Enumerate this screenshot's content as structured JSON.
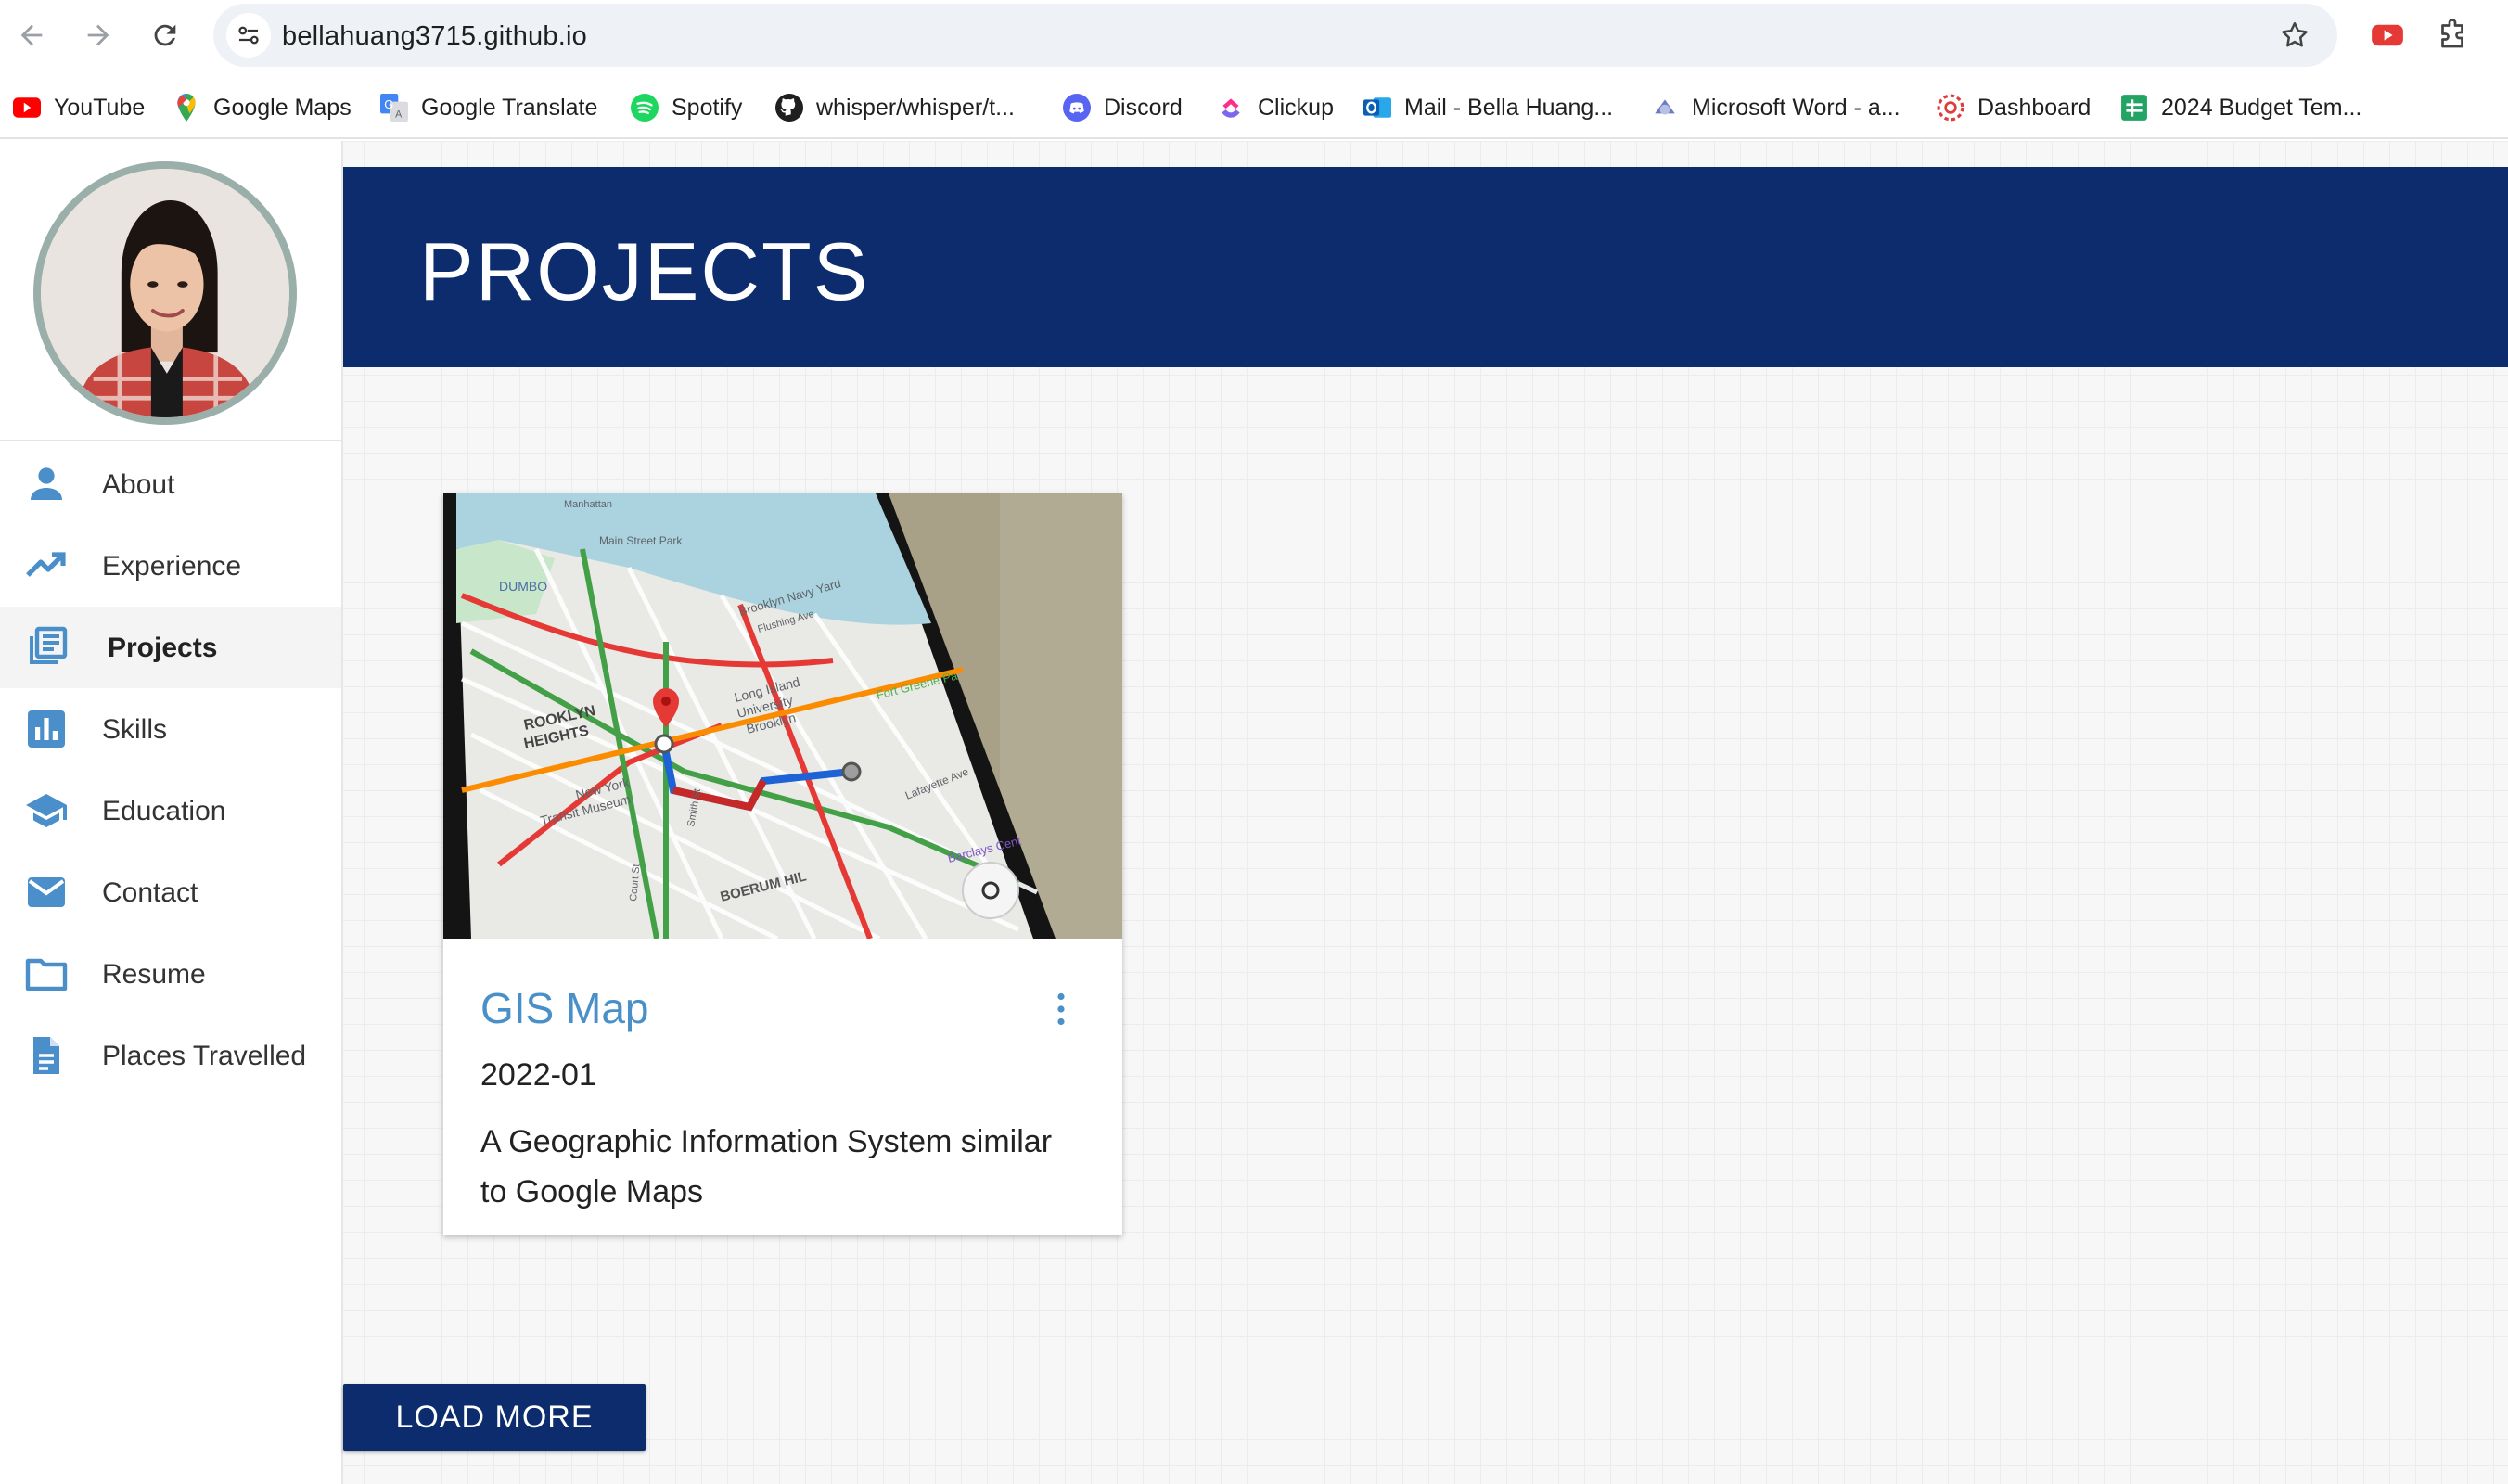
{
  "browser": {
    "url": "bellahuang3715.github.io",
    "bookmarks": [
      {
        "label": "YouTube",
        "icon": "youtube-icon"
      },
      {
        "label": "Google Maps",
        "icon": "google-maps-icon"
      },
      {
        "label": "Google Translate",
        "icon": "google-translate-icon"
      },
      {
        "label": "Spotify",
        "icon": "spotify-icon"
      },
      {
        "label": "whisper/whisper/t...",
        "icon": "github-icon"
      },
      {
        "label": "Discord",
        "icon": "discord-icon"
      },
      {
        "label": "Clickup",
        "icon": "clickup-icon"
      },
      {
        "label": "Mail - Bella Huang...",
        "icon": "outlook-icon"
      },
      {
        "label": "Microsoft Word - a...",
        "icon": "word-icon"
      },
      {
        "label": "Dashboard",
        "icon": "dashboard-icon"
      },
      {
        "label": "2024 Budget Tem...",
        "icon": "google-sheets-icon"
      }
    ]
  },
  "sidebar": {
    "items": [
      {
        "label": "About",
        "icon": "person-icon"
      },
      {
        "label": "Experience",
        "icon": "trending-up-icon"
      },
      {
        "label": "Projects",
        "icon": "library-books-icon",
        "active": true
      },
      {
        "label": "Skills",
        "icon": "bar-chart-icon"
      },
      {
        "label": "Education",
        "icon": "school-icon"
      },
      {
        "label": "Contact",
        "icon": "mail-icon"
      },
      {
        "label": "Resume",
        "icon": "folder-icon"
      },
      {
        "label": "Places Travelled",
        "icon": "document-icon"
      }
    ]
  },
  "header": {
    "title": "PROJECTS"
  },
  "projects": [
    {
      "title": "GIS Map",
      "date": "2022-01",
      "description": "A Geographic Information System similar to Google Maps",
      "image_icon": "map-screenshot-image",
      "map_labels": [
        "DUMBO",
        "Brooklyn Navy Yard",
        "ROOKLYN HEIGHTS",
        "Long Island University Brooklyn",
        "Fort Greene Pa",
        "New York Transit Museum",
        "BOERUM HIL",
        "Barclays Cent",
        "Lafayette Ave",
        "Main Street Park",
        "Flushing Ave",
        "Manhattan",
        "Court St",
        "Smith St"
      ]
    }
  ],
  "load_more": {
    "label": "LOAD MORE"
  },
  "colors": {
    "header_bg": "#0c2c6d",
    "accent": "#4a90c8",
    "icon_blue": "#4a8fc9"
  }
}
